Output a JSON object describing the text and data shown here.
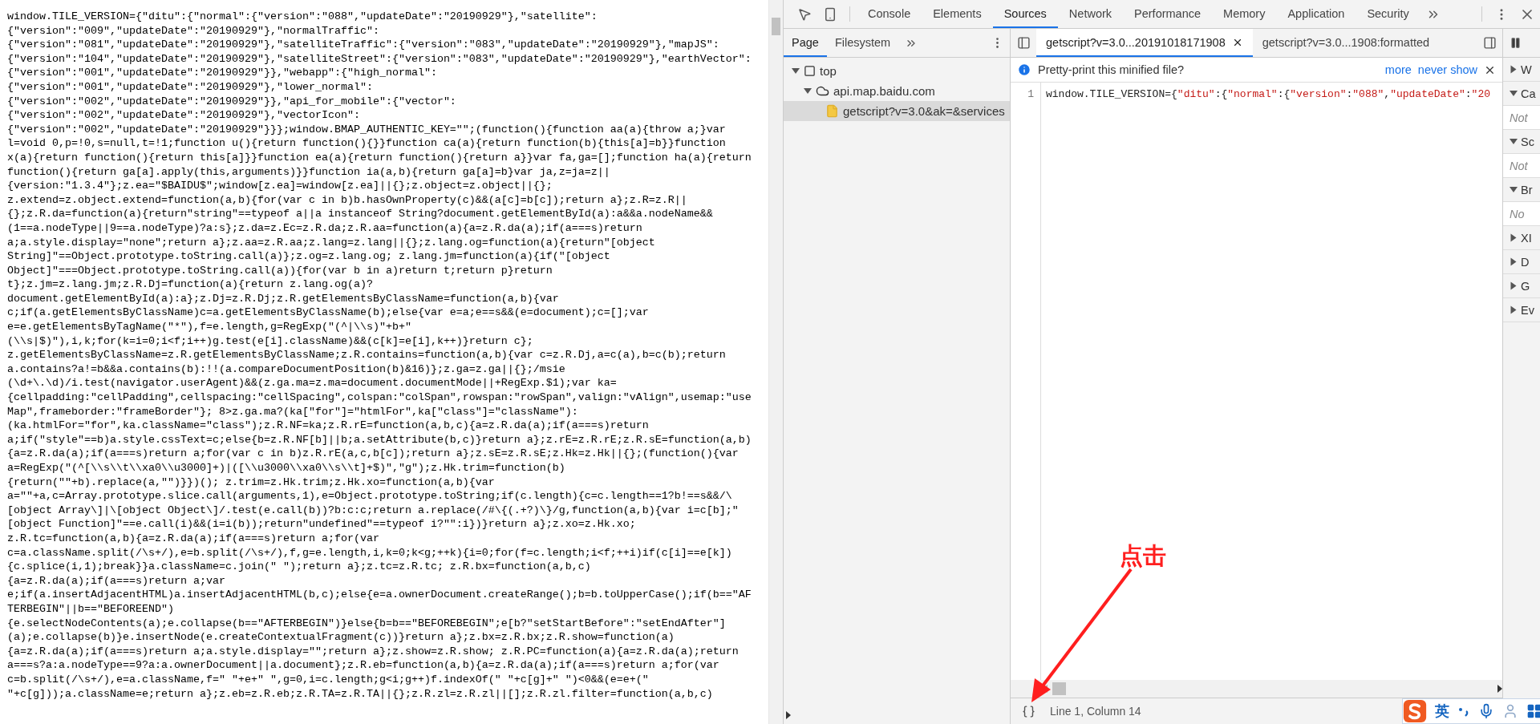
{
  "source_page": {
    "lines": [
      "window.TILE_VERSION={\"ditu\":{\"normal\":{\"version\":\"088\",\"updateDate\":\"20190929\"},\"satellite\":",
      "{\"version\":\"009\",\"updateDate\":\"20190929\"},\"normalTraffic\":",
      "{\"version\":\"081\",\"updateDate\":\"20190929\"},\"satelliteTraffic\":{\"version\":\"083\",\"updateDate\":\"20190929\"},\"mapJS\":",
      "{\"version\":\"104\",\"updateDate\":\"20190929\"},\"satelliteStreet\":{\"version\":\"083\",\"updateDate\":\"20190929\"},\"earthVector\":",
      "{\"version\":\"001\",\"updateDate\":\"20190929\"}},\"webapp\":{\"high_normal\":",
      "{\"version\":\"001\",\"updateDate\":\"20190929\"},\"lower_normal\":",
      "{\"version\":\"002\",\"updateDate\":\"20190929\"}},\"api_for_mobile\":{\"vector\":",
      "{\"version\":\"002\",\"updateDate\":\"20190929\"},\"vectorIcon\":",
      "{\"version\":\"002\",\"updateDate\":\"20190929\"}}};window.BMAP_AUTHENTIC_KEY=\"\";(function(){function aa(a){throw a;}var",
      "l=void 0,p=!0,s=null,t=!1;function u(){return function(){}}function ca(a){return function(b){this[a]=b}}function",
      "x(a){return function(){return this[a]}}function ea(a){return function(){return a}}var fa,ga=[];function ha(a){return",
      "function(){return ga[a].apply(this,arguments)}}function ia(a,b){return ga[a]=b}var ja,z=ja=z||",
      "{version:\"1.3.4\"};z.ea=\"$BAIDU$\";window[z.ea]=window[z.ea]||{};z.object=z.object||{};",
      "z.extend=z.object.extend=function(a,b){for(var c in b)b.hasOwnProperty(c)&&(a[c]=b[c]);return a};z.R=z.R||",
      "{};z.R.da=function(a){return\"string\"==typeof a||a instanceof String?document.getElementById(a):a&&a.nodeName&&",
      "(1==a.nodeType||9==a.nodeType)?a:s};z.da=z.Ec=z.R.da;z.R.aa=function(a){a=z.R.da(a);if(a===s)return",
      "a;a.style.display=\"none\";return a};z.aa=z.R.aa;z.lang=z.lang||{};z.lang.og=function(a){return\"[object",
      "String]\"==Object.prototype.toString.call(a)};z.og=z.lang.og; z.lang.jm=function(a){if(\"[object",
      "Object]\"===Object.prototype.toString.call(a)){for(var b in a)return t;return p}return",
      "t};z.jm=z.lang.jm;z.R.Dj=function(a){return z.lang.og(a)?",
      "document.getElementById(a):a};z.Dj=z.R.Dj;z.R.getElementsByClassName=function(a,b){var",
      "c;if(a.getElementsByClassName)c=a.getElementsByClassName(b);else{var e=a;e==s&&(e=document);c=[];var",
      "e=e.getElementsByTagName(\"*\"),f=e.length,g=RegExp(\"(^|\\\\s)\"+b+\"",
      "(\\\\s|$)\"),i,k;for(k=i=0;i<f;i++)g.test(e[i].className)&&(c[k]=e[i],k++)}return c};",
      "z.getElementsByClassName=z.R.getElementsByClassName;z.R.contains=function(a,b){var c=z.R.Dj,a=c(a),b=c(b);return",
      "a.contains?a!=b&&a.contains(b):!!(a.compareDocumentPosition(b)&16)};z.ga=z.ga||{};/msie",
      "(\\d+\\.\\d)/i.test(navigator.userAgent)&&(z.ga.ma=z.ma=document.documentMode||+RegExp.$1);var ka=",
      "{cellpadding:\"cellPadding\",cellspacing:\"cellSpacing\",colspan:\"colSpan\",rowspan:\"rowSpan\",valign:\"vAlign\",usemap:\"use",
      "Map\",frameborder:\"frameBorder\"}; 8>z.ga.ma?(ka[\"for\"]=\"htmlFor\",ka[\"class\"]=\"className\"):",
      "(ka.htmlFor=\"for\",ka.className=\"class\");z.R.NF=ka;z.R.rE=function(a,b,c){a=z.R.da(a);if(a===s)return",
      "a;if(\"style\"==b)a.style.cssText=c;else{b=z.R.NF[b]||b;a.setAttribute(b,c)}return a};z.rE=z.R.rE;z.R.sE=function(a,b)",
      "{a=z.R.da(a);if(a===s)return a;for(var c in b)z.R.rE(a,c,b[c]);return a};z.sE=z.R.sE;z.Hk=z.Hk||{};(function(){var",
      "a=RegExp(\"(^[\\\\s\\\\t\\\\xa0\\\\u3000]+)|([\\\\u3000\\\\xa0\\\\s\\\\t]+$)\",\"g\");z.Hk.trim=function(b)",
      "{return(\"\"+b).replace(a,\"\")}})(); z.trim=z.Hk.trim;z.Hk.xo=function(a,b){var",
      "a=\"\"+a,c=Array.prototype.slice.call(arguments,1),e=Object.prototype.toString;if(c.length){c=c.length==1?b!==s&&/\\",
      "[object Array\\]|\\[object Object\\]/.test(e.call(b))?b:c:c;return a.replace(/#\\{(.+?)\\}/g,function(a,b){var i=c[b];\"",
      "[object Function]\"==e.call(i)&&(i=i(b));return\"undefined\"==typeof i?\"\":i})}return a};z.xo=z.Hk.xo;",
      "z.R.tc=function(a,b){a=z.R.da(a);if(a===s)return a;for(var",
      "c=a.className.split(/\\s+/),e=b.split(/\\s+/),f,g=e.length,i,k=0;k<g;++k){i=0;for(f=c.length;i<f;++i)if(c[i]==e[k])",
      "{c.splice(i,1);break}}a.className=c.join(\" \");return a};z.tc=z.R.tc; z.R.bx=function(a,b,c)",
      "{a=z.R.da(a);if(a===s)return a;var",
      "e;if(a.insertAdjacentHTML)a.insertAdjacentHTML(b,c);else{e=a.ownerDocument.createRange();b=b.toUpperCase();if(b==\"AF",
      "TERBEGIN\"||b==\"BEFOREEND\")",
      "{e.selectNodeContents(a);e.collapse(b==\"AFTERBEGIN\")}else{b=b==\"BEFOREBEGIN\";e[b?\"setStartBefore\":\"setEndAfter\"]",
      "(a);e.collapse(b)}e.insertNode(e.createContextualFragment(c))}return a};z.bx=z.R.bx;z.R.show=function(a)",
      "{a=z.R.da(a);if(a===s)return a;a.style.display=\"\";return a};z.show=z.R.show; z.R.PC=function(a){a=z.R.da(a);return",
      "a===s?a:a.nodeType==9?a:a.ownerDocument||a.document};z.R.eb=function(a,b){a=z.R.da(a);if(a===s)return a;for(var",
      "c=b.split(/\\s+/),e=a.className,f=\" \"+e+\" \",g=0,i=c.length;g<i;g++)f.indexOf(\" \"+c[g]+\" \")<0&&(e=e+(\"",
      "\"+c[g]));a.className=e;return a};z.eb=z.R.eb;z.R.TA=z.R.TA||{};z.R.zl=z.R.zl||[];z.R.zl.filter=function(a,b,c)"
    ]
  },
  "devtools": {
    "tabs": [
      {
        "label": "Console",
        "selected": false
      },
      {
        "label": "Elements",
        "selected": false
      },
      {
        "label": "Sources",
        "selected": true
      },
      {
        "label": "Network",
        "selected": false
      },
      {
        "label": "Performance",
        "selected": false
      },
      {
        "label": "Memory",
        "selected": false
      },
      {
        "label": "Application",
        "selected": false
      },
      {
        "label": "Security",
        "selected": false
      }
    ],
    "navigator": {
      "tabs": [
        {
          "label": "Page",
          "selected": true
        },
        {
          "label": "Filesystem",
          "selected": false
        }
      ],
      "tree": [
        {
          "label": "top",
          "kind": "frame",
          "expanded": true,
          "selected": false,
          "children": [
            {
              "label": "api.map.baidu.com",
              "kind": "domain",
              "expanded": true,
              "selected": false,
              "children": [
                {
                  "label": "getscript?v=3.0&ak=&services",
                  "kind": "file",
                  "selected": true
                }
              ]
            }
          ]
        }
      ]
    },
    "editor": {
      "tabs": [
        {
          "label": "getscript?v=3.0...20191018171908",
          "selected": true
        },
        {
          "label": "getscript?v=3.0...1908:formatted",
          "selected": false
        }
      ],
      "infobar": {
        "message": "Pretty-print this minified file?",
        "links": [
          "more",
          "never show"
        ]
      },
      "lines": [
        {
          "number": "1",
          "text": "window.TILE_VERSION={\"ditu\":{\"normal\":{\"version\":\"088\",\"updateDate\":\"20"
        }
      ],
      "status": "Line 1, Column 14"
    },
    "sidebar": [
      {
        "label": "W",
        "expanded": false
      },
      {
        "label": "Ca",
        "expanded": true,
        "note": "Not"
      },
      {
        "label": "Sc",
        "expanded": true,
        "note": "Not"
      },
      {
        "label": "Br",
        "expanded": true,
        "note": "No"
      },
      {
        "label": "XI",
        "expanded": false
      },
      {
        "label": "D",
        "expanded": false
      },
      {
        "label": "G",
        "expanded": false
      },
      {
        "label": "Ev",
        "expanded": false
      }
    ]
  },
  "ime": {
    "mode": "英"
  },
  "annotation": {
    "text": "点击"
  }
}
